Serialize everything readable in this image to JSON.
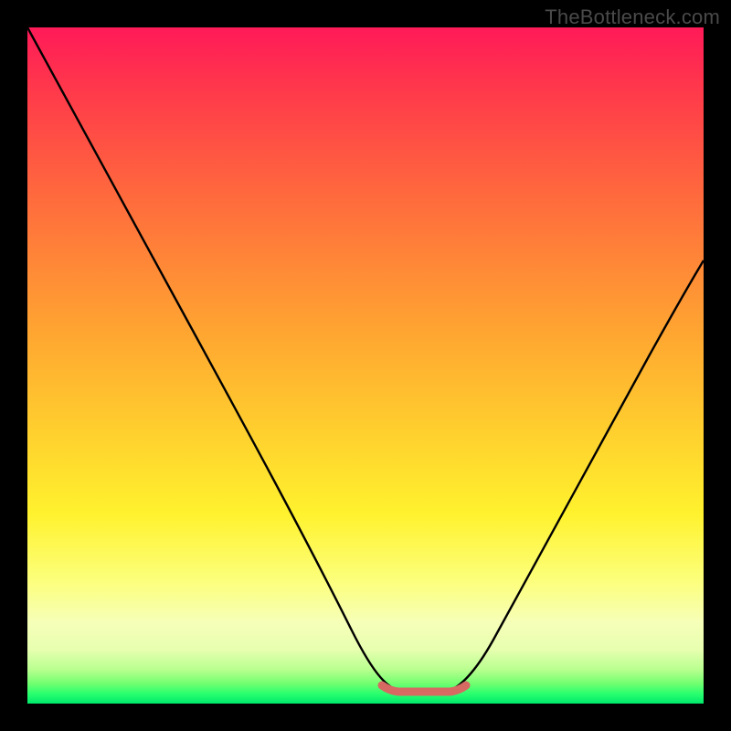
{
  "watermark": "TheBottleneck.com",
  "colors": {
    "frame": "#000000",
    "curve": "#000000",
    "flat_segment": "#d66a63",
    "gradient_top": "#ff1a58",
    "gradient_bottom": "#00e86c"
  },
  "chart_data": {
    "type": "line",
    "title": "",
    "xlabel": "",
    "ylabel": "",
    "xlim": [
      0,
      100
    ],
    "ylim": [
      0,
      100
    ],
    "grid": false,
    "legend": false,
    "series": [
      {
        "name": "bottleneck-curve",
        "x": [
          0,
          5,
          10,
          15,
          20,
          25,
          30,
          35,
          40,
          45,
          50,
          53,
          56,
          60,
          63,
          65,
          70,
          75,
          80,
          85,
          90,
          95,
          100
        ],
        "y": [
          100,
          91,
          82,
          73,
          64,
          55,
          46,
          37,
          28,
          19,
          10,
          4,
          1.8,
          1.5,
          1.8,
          4,
          11,
          19,
          27,
          35,
          43,
          50,
          57
        ]
      },
      {
        "name": "flat-minimum",
        "x": [
          53,
          63
        ],
        "y": [
          1.7,
          1.7
        ]
      }
    ],
    "annotations": []
  }
}
